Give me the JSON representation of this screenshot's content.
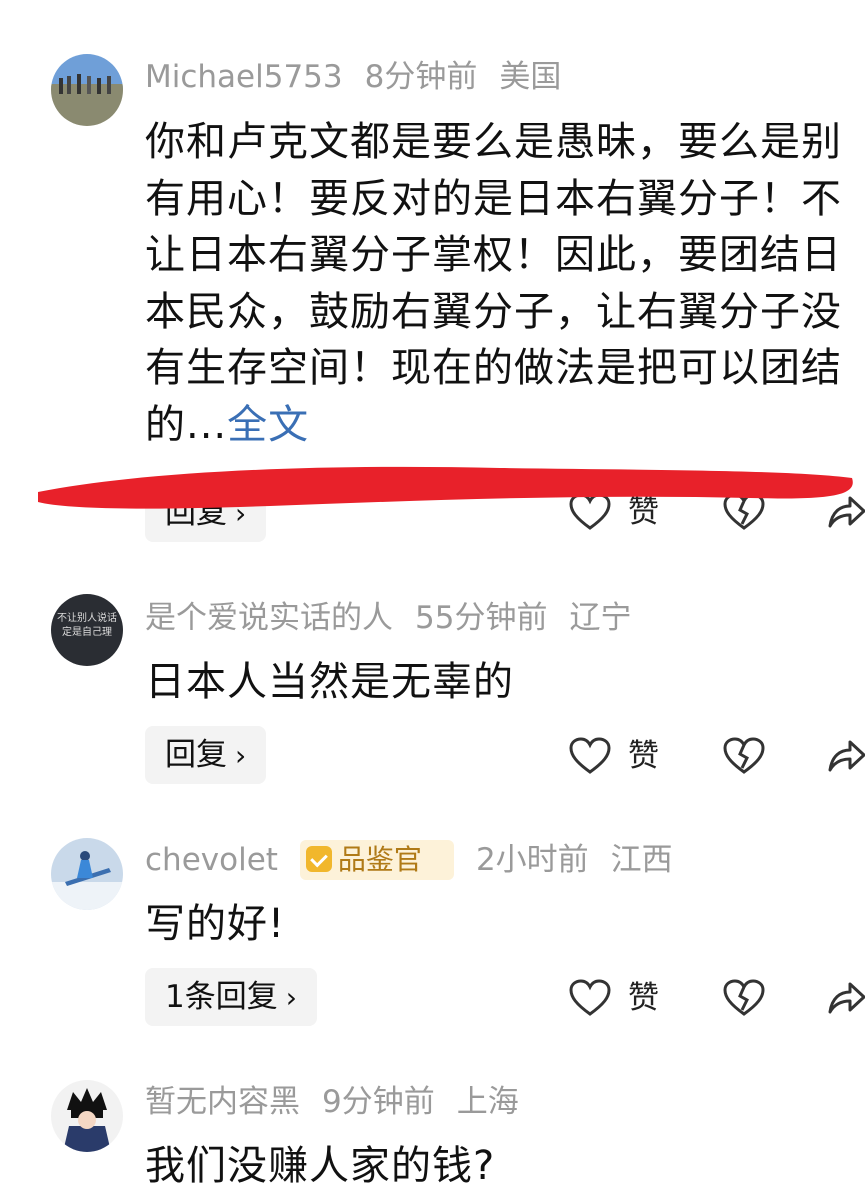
{
  "comments": [
    {
      "username": "Michael5753",
      "time": "8分钟前",
      "location": "美国",
      "text": "你和卢克文都是要么是愚昧，要么是别有用心！要反对的是日本右翼分子！不让日本右翼分子掌权！因此，要团结日本民众，鼓励右翼分子，让右翼分子没有生存空间！现在的做法是把可以团结的...",
      "more_label": "全文",
      "reply_label": "回复",
      "like_label": "赞"
    },
    {
      "username": "是个爱说实话的人",
      "time": "55分钟前",
      "location": "辽宁",
      "text": "日本人当然是无辜的",
      "reply_label": "回复",
      "like_label": "赞",
      "avatar_text": "不让别人说话 定是自己理"
    },
    {
      "username": "chevolet",
      "badge": "品鉴官",
      "time": "2小时前",
      "location": "江西",
      "text": "写的好!",
      "reply_label": "1条回复",
      "like_label": "赞"
    },
    {
      "username": "暂无内容黑",
      "time": "9分钟前",
      "location": "上海",
      "text": "我们没赚人家的钱?"
    }
  ],
  "icons": {
    "like": "heart-outline-icon",
    "dislike": "broken-heart-icon",
    "share": "share-arrow-icon",
    "chevron": "chevron-right-icon"
  },
  "colors": {
    "link": "#3a6fb5",
    "annotation": "#e8212a",
    "badge_bg": "#fdf2d9",
    "badge_fg": "#b07a17"
  }
}
